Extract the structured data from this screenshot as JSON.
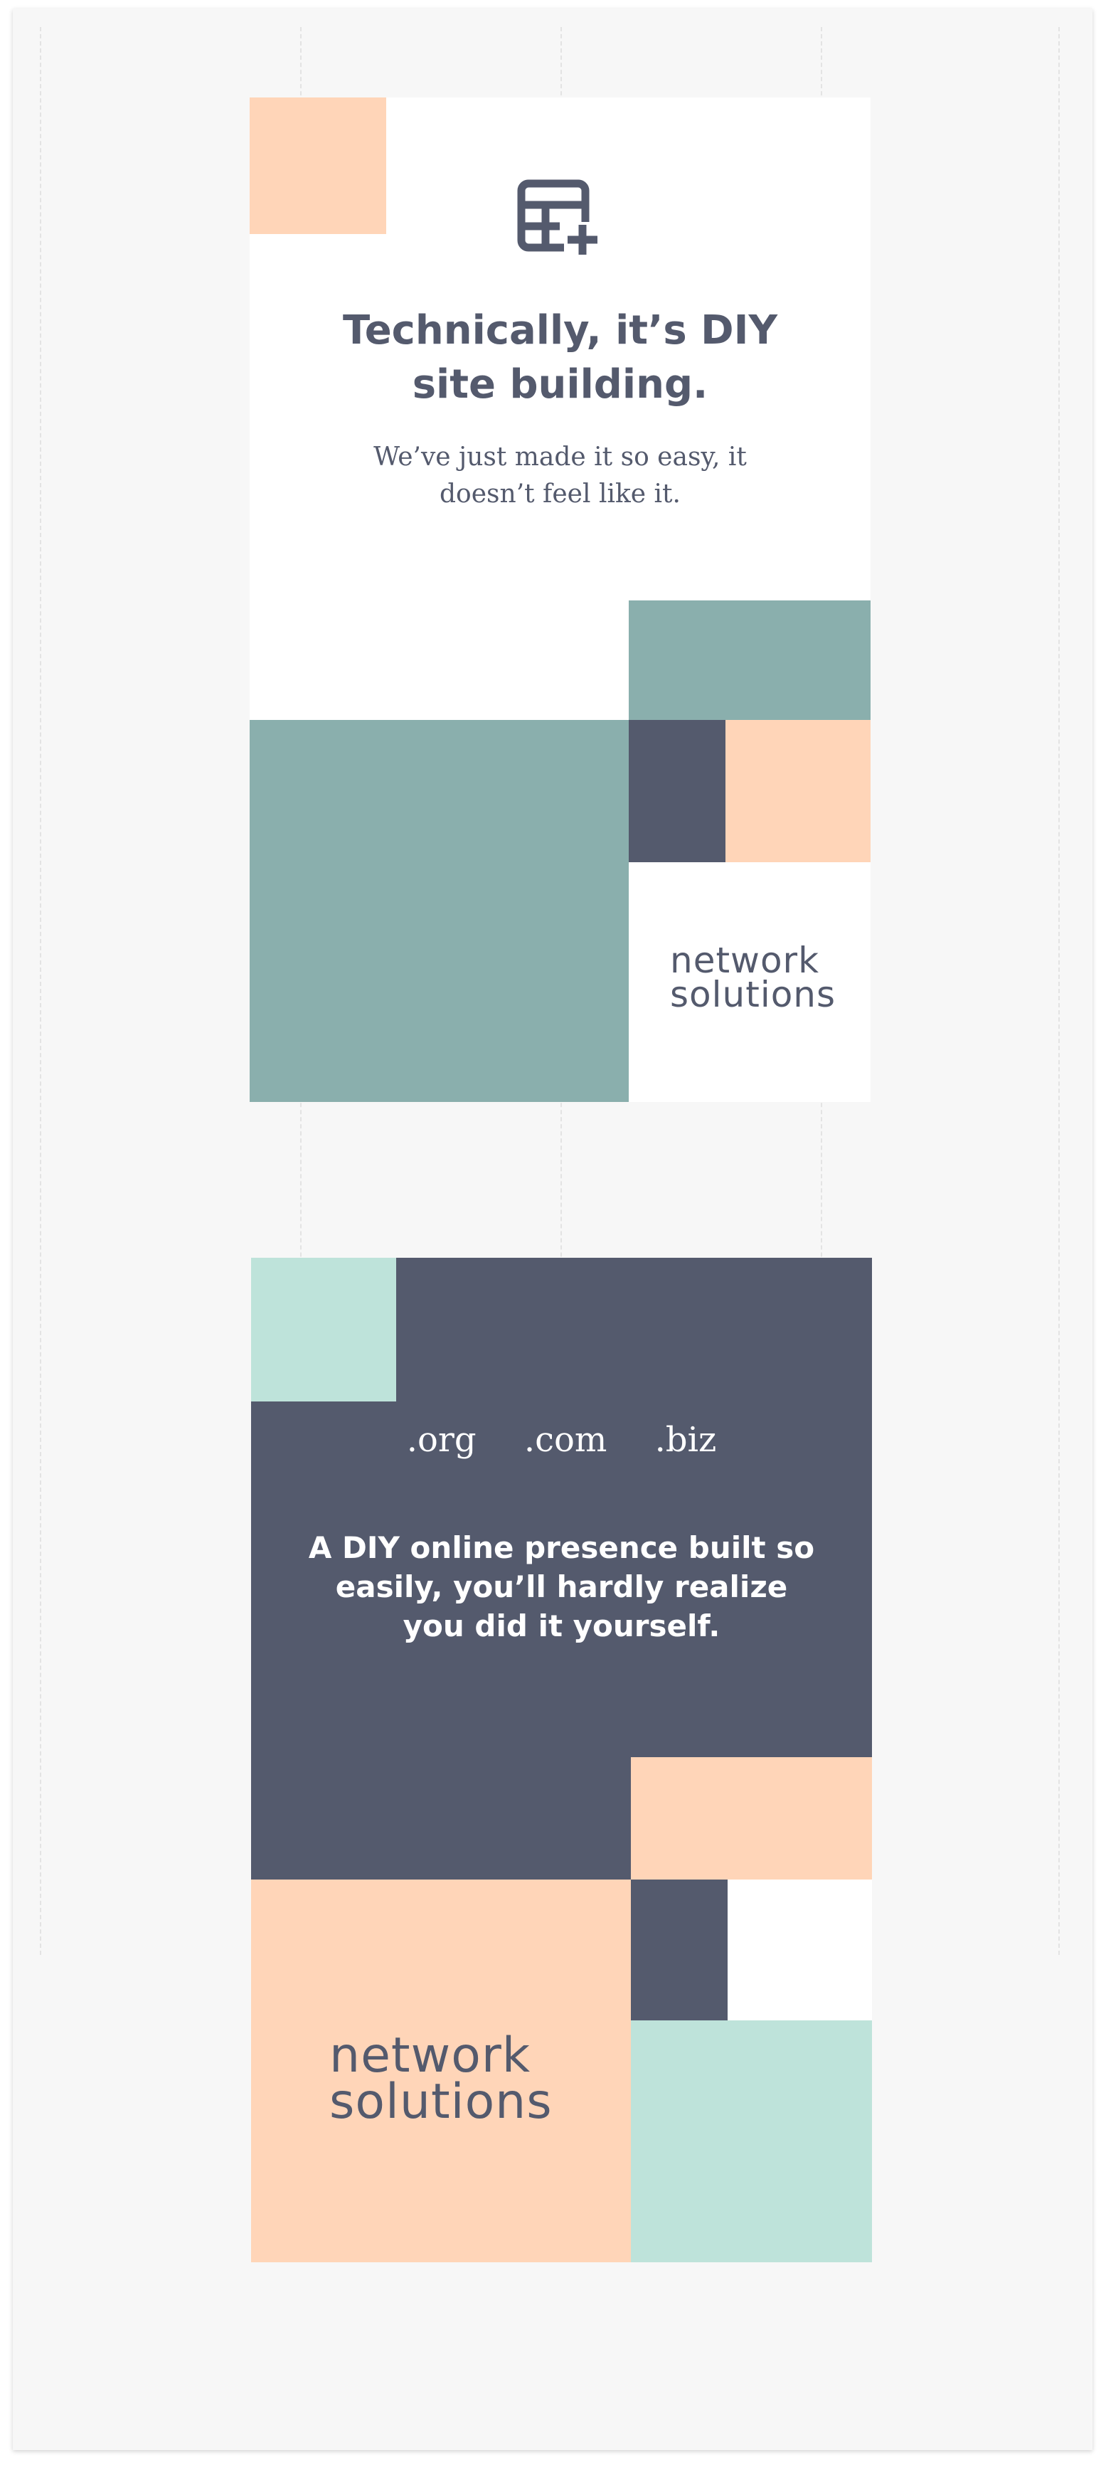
{
  "colors": {
    "background": "#f7f7f7",
    "slate": "#545a6d",
    "peach": "#ffd5b8",
    "teal": "#8aafad",
    "mint": "#bee3da",
    "white": "#ffffff"
  },
  "panel1": {
    "icon": "table-plus-icon",
    "headline": [
      "Technically, it’s DIY",
      "site building."
    ],
    "subtext": [
      "We’ve just made it so easy, it",
      "doesn’t feel like it."
    ],
    "logo": [
      "network",
      "solutions"
    ]
  },
  "panel2": {
    "domains": [
      ".org",
      ".com",
      ".biz"
    ],
    "body": [
      "A DIY online presence built so",
      "easily, you’ll hardly realize",
      "you did it yourself."
    ],
    "logo": [
      "network",
      "solutions"
    ]
  }
}
